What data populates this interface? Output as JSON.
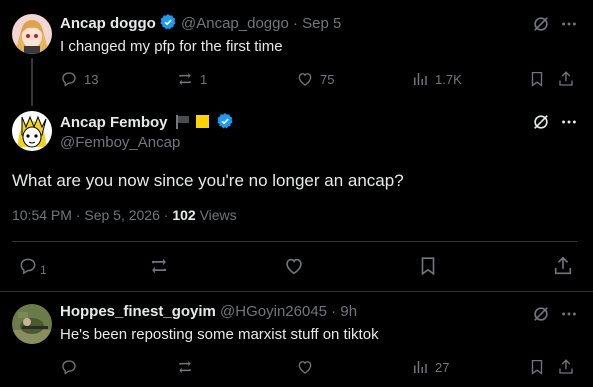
{
  "parent_tweet": {
    "display_name": "Ancap doggo",
    "handle": "@Ancap_doggo",
    "time": "Sep 5",
    "text": "I changed my pfp for the first time",
    "replies": "13",
    "reposts": "1",
    "likes": "75",
    "views": "1.7K"
  },
  "main_tweet": {
    "display_name": "Ancap Femboy",
    "handle": "@Femboy_Ancap",
    "text": "What are you now since you're no longer an ancap?",
    "timestamp": "10:54 PM · Sep 5, 2026 · ",
    "views_count": "102",
    "views_label": "Views",
    "replies": "1"
  },
  "reply_tweet": {
    "display_name": "Hoppes_finest_goyim",
    "handle": "@HGoyin26045",
    "time": "9h",
    "text": "He's been reposting some marxist stuff on tiktok",
    "views": "27"
  },
  "colors": {
    "verified": "#1d9bf0",
    "muted": "#71767b",
    "divider": "#2f3336",
    "flag_yellow": "#ffd400"
  }
}
